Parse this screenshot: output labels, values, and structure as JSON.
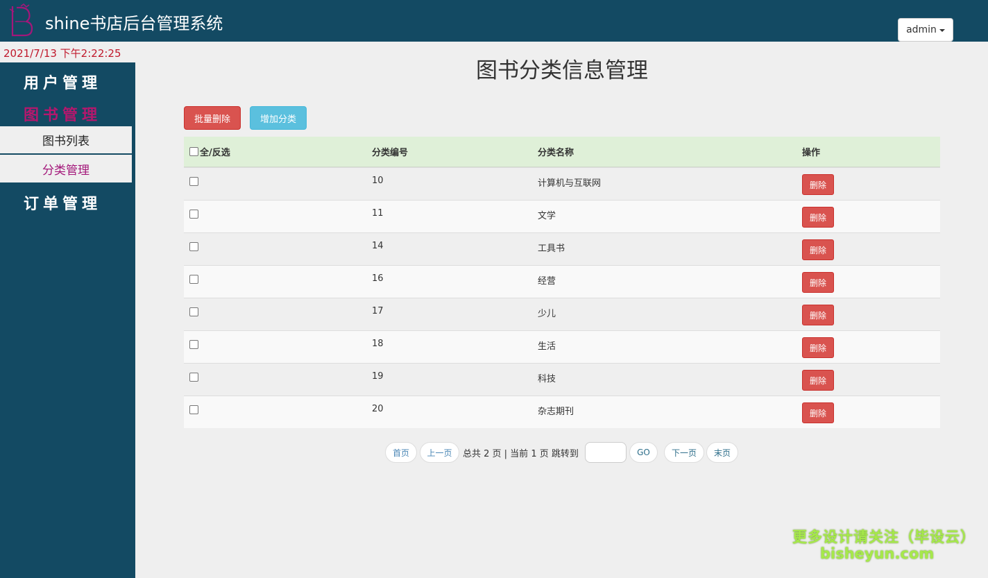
{
  "header": {
    "app_title": "shine书店后台管理系统",
    "user_menu_label": "admin",
    "logo_icon": "bookstore-logo-icon"
  },
  "datetime": "2021/7/13 下午2:22:25",
  "sidebar": {
    "groups": [
      {
        "label": "用户管理",
        "active": false
      },
      {
        "label": "图书管理",
        "active": true
      },
      {
        "label": "订单管理",
        "active": false
      }
    ],
    "subitems": [
      {
        "label": "图书列表",
        "current": false
      },
      {
        "label": "分类管理",
        "current": true
      }
    ]
  },
  "main": {
    "title": "图书分类信息管理",
    "batch_delete_label": "批量删除",
    "add_category_label": "增加分类",
    "table": {
      "headers": {
        "select_all": "全/反选",
        "id": "分类编号",
        "name": "分类名称",
        "action": "操作"
      },
      "delete_label": "删除",
      "rows": [
        {
          "id": "10",
          "name": "计算机与互联网"
        },
        {
          "id": "11",
          "name": "文学"
        },
        {
          "id": "14",
          "name": "工具书"
        },
        {
          "id": "16",
          "name": "经营"
        },
        {
          "id": "17",
          "name": "少儿"
        },
        {
          "id": "18",
          "name": "生活"
        },
        {
          "id": "19",
          "name": "科技"
        },
        {
          "id": "20",
          "name": "杂志期刊"
        }
      ]
    },
    "pager": {
      "first": "首页",
      "prev": "上一页",
      "info": "总共 2 页 | 当前 1 页 跳转到",
      "go": "GO",
      "next": "下一页",
      "last": "末页"
    }
  },
  "watermark": {
    "line1": "更多设计请关注（毕设云）",
    "line2": "bisheyun.com"
  },
  "colors": {
    "header_bg": "#134a63",
    "accent_magenta": "#b5176d",
    "danger": "#d9534f",
    "info": "#5bc0de",
    "table_head_bg": "#dff0d8"
  }
}
